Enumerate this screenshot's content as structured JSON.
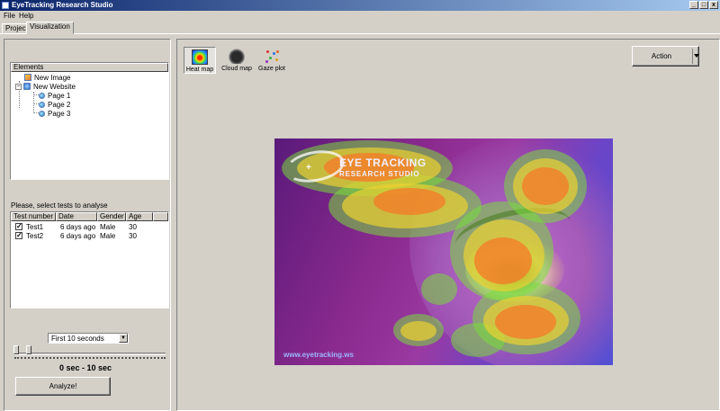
{
  "window": {
    "title": "EyeTracking Research Studio",
    "controls": [
      "_",
      "□",
      "x"
    ]
  },
  "menu": [
    "File",
    "Help"
  ],
  "tabs": [
    {
      "label": "Project",
      "active": false
    },
    {
      "label": "Visualization",
      "active": true
    }
  ],
  "elements": {
    "header": "Elements",
    "tree": {
      "image": "New Image",
      "website": "New Website",
      "pages": [
        "Page 1",
        "Page 2",
        "Page 3"
      ]
    }
  },
  "tests": {
    "instruction": "Please, select tests to analyse",
    "columns": [
      "Test number",
      "Date",
      "Gender",
      "Age"
    ],
    "rows": [
      {
        "name": "Test1",
        "date": "6 days ago",
        "gender": "Male",
        "age": "30",
        "checked": true
      },
      {
        "name": "Test2",
        "date": "6 days ago",
        "gender": "Male",
        "age": "30",
        "checked": true
      }
    ]
  },
  "time_filter": {
    "selected": "First 10 seconds",
    "range_label": "0 sec - 10 sec"
  },
  "analyze_label": "Analyze!",
  "visualization_types": [
    {
      "label": "Heat map",
      "icon": "heat-map-icon",
      "active": true
    },
    {
      "label": "Cloud map",
      "icon": "cloud-map-icon",
      "active": false
    },
    {
      "label": "Gaze plot",
      "icon": "gaze-plot-icon",
      "active": false
    }
  ],
  "action_label": "Action",
  "stimulus": {
    "logo_title": "EYE TRACKING",
    "logo_subtitle": "RESEARCH STUDIO",
    "url": "www.eyetracking.ws"
  },
  "colors": {
    "window_face": "#d4d0c8",
    "title_start": "#0a246a",
    "title_end": "#a6caf0",
    "heat_low": "#78dc3c",
    "heat_mid": "#ebd232",
    "heat_high": "#f57828"
  }
}
